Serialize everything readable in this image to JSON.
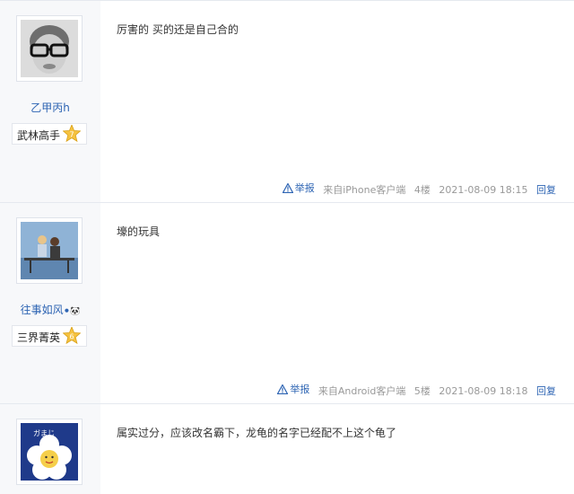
{
  "posts": [
    {
      "username": "乙甲丙h",
      "badge": {
        "title": "武林高手",
        "level": "7"
      },
      "content": "厉害的 买的还是自己合的",
      "report_label": "举报",
      "source": "来自iPhone客户端",
      "floor": "4楼",
      "time": "2021-08-09 18:15",
      "reply_label": "回复"
    },
    {
      "username": "往事如风",
      "username_emoji": "⚫🐼",
      "badge": {
        "title": "三界菁英",
        "level": "6"
      },
      "content": "壕的玩具",
      "report_label": "举报",
      "source": "来自Android客户端",
      "floor": "5楼",
      "time": "2021-08-09 18:18",
      "reply_label": "回复"
    },
    {
      "content": "属实过分，应该改名霸下，龙龟的名字已经配不上这个龟了",
      "avatar_text": "ガまじ"
    }
  ],
  "colors": {
    "link": "#2d64b3",
    "meta": "#999999",
    "sidebar_bg": "#f7f8fa",
    "badge_star": "#f5c240"
  }
}
